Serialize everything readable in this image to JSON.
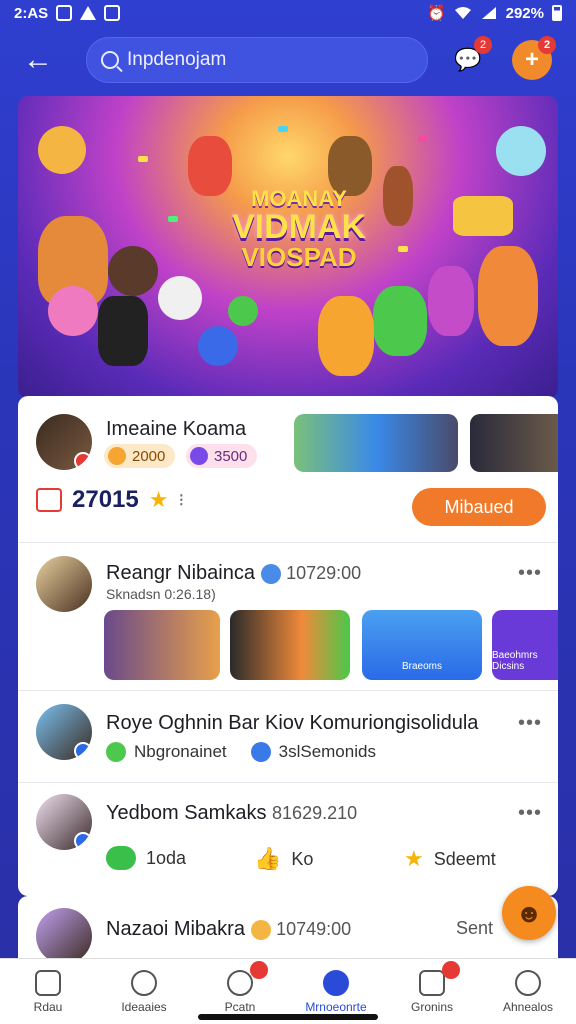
{
  "status_bar": {
    "time": "2:AS",
    "battery": "292%"
  },
  "search": {
    "value": "Inpdenojam"
  },
  "header": {
    "messages_badge": "2",
    "add_badge": "2"
  },
  "banner": {
    "title_line1": "MOANAY",
    "title_line2": "VIDMAK",
    "title_line3": "VIOSPAD"
  },
  "profile": {
    "name": "Imeaine Koama",
    "pill1": "2000",
    "pill2": "3500",
    "stat": "27015",
    "follow_label": "Mibaued"
  },
  "posts": [
    {
      "name": "Reangr Nibainca",
      "time": "10729:00",
      "sub": "Sknadsn 0:26.18)"
    },
    {
      "name": "Roye Oghnin Bar Kiov Komuriongisolidula",
      "meta1": "Nbgronainet",
      "meta2": "3slSemonids"
    },
    {
      "name": "Yedbom Samkaks",
      "time": "81629.210",
      "action1": "1oda",
      "action2": "Ko",
      "action3": "Sdeemt"
    },
    {
      "name": "Nazaoi Mibakra",
      "time": "10749:00",
      "action": "Sent"
    }
  ],
  "media_thumbs": [
    "",
    "",
    "",
    "Braeoms",
    "Baeohmrs Dicsins"
  ],
  "nav": [
    {
      "label": "Rdau",
      "icon": "home-icon",
      "badge": ""
    },
    {
      "label": "Ideaaies",
      "icon": "chat-icon",
      "badge": ""
    },
    {
      "label": "Pcatn",
      "icon": "people-icon",
      "badge": ""
    },
    {
      "label": "Mrnoeonrte",
      "icon": "video-icon",
      "badge": ""
    },
    {
      "label": "Gronins",
      "icon": "group-icon",
      "badge": ""
    },
    {
      "label": "Ahnealos",
      "icon": "profile-icon",
      "badge": ""
    }
  ],
  "colors": {
    "primary": "#2a4bd8",
    "accent": "#f07a2a",
    "header_bg": "#2f3fd0"
  }
}
